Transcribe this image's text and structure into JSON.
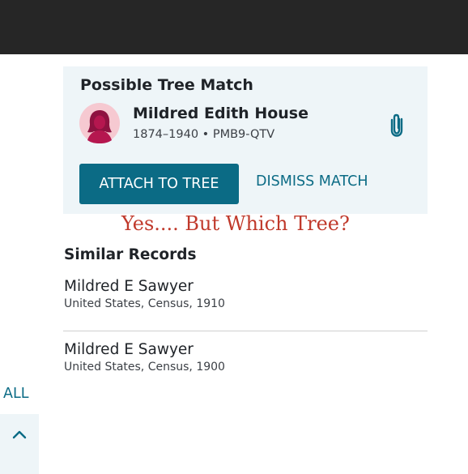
{
  "tree_match": {
    "title": "Possible Tree Match",
    "person": {
      "name": "Mildred Edith House",
      "meta": "1874–1940 • PMB9-QTV"
    },
    "attach_label": "ATTACH TO TREE",
    "dismiss_label": "DISMISS MATCH",
    "attach_icon": "paperclip-icon"
  },
  "annotation": "Yes.... But Which Tree?",
  "similar": {
    "title": "Similar Records",
    "records": [
      {
        "name": "Mildred E Sawyer",
        "source": "United States, Census, 1910"
      },
      {
        "name": "Mildred E Sawyer",
        "source": "United States, Census, 1900"
      }
    ]
  },
  "left_rail": {
    "all_label": "ALL",
    "scroll_icon": "chevron-up-icon"
  },
  "colors": {
    "header": "#262626",
    "card_bg": "#eef5f8",
    "accent": "#0b6b85",
    "annotation": "#c0392b",
    "avatar_bg": "#f6c9d1",
    "avatar_figure": "#b5174f"
  }
}
